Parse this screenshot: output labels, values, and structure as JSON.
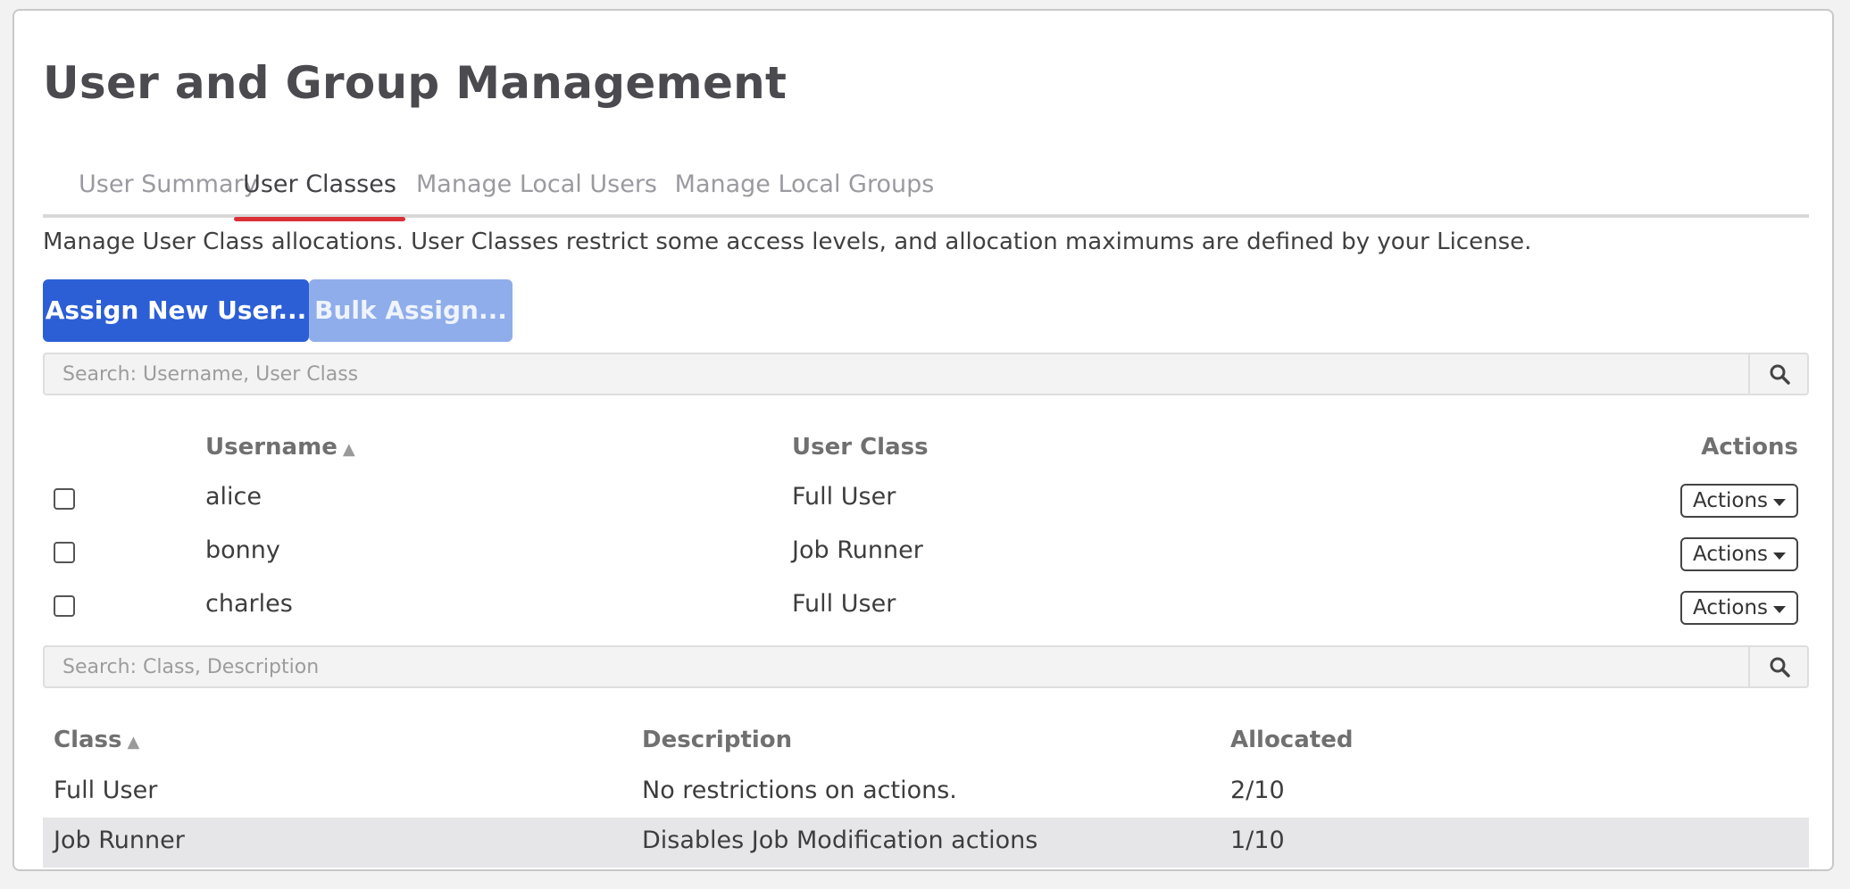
{
  "page": {
    "title": "User and Group Management"
  },
  "tabs": [
    {
      "label": "User Summary",
      "active": false
    },
    {
      "label": "User Classes",
      "active": true
    },
    {
      "label": "Manage Local Users",
      "active": false
    },
    {
      "label": "Manage Local Groups",
      "active": false
    }
  ],
  "intro_text": "Manage User Class allocations. User Classes restrict some access levels, and allocation maximums are defined by your License.",
  "toolbar": {
    "assign_label": "Assign New User...",
    "bulk_label": "Bulk Assign..."
  },
  "user_search": {
    "placeholder": "Search: Username, User Class",
    "value": ""
  },
  "users_table": {
    "headers": {
      "username": "Username",
      "user_class": "User Class",
      "actions": "Actions"
    },
    "sort_indicator": "▲",
    "rows": [
      {
        "username": "alice",
        "user_class": "Full User",
        "action_label": "Actions",
        "checked": false
      },
      {
        "username": "bonny",
        "user_class": "Job Runner",
        "action_label": "Actions",
        "checked": false
      },
      {
        "username": "charles",
        "user_class": "Full User",
        "action_label": "Actions",
        "checked": false
      }
    ]
  },
  "class_search": {
    "placeholder": "Search: Class, Description",
    "value": ""
  },
  "classes_table": {
    "headers": {
      "class": "Class",
      "description": "Description",
      "allocated": "Allocated"
    },
    "sort_indicator": "▲",
    "rows": [
      {
        "class": "Full User",
        "description": "No restrictions on actions.",
        "allocated": "2/10"
      },
      {
        "class": "Job Runner",
        "description": "Disables Job Modification actions",
        "allocated": "1/10"
      }
    ]
  },
  "colors": {
    "primary": "#2c5fd6",
    "primary_disabled": "#8fadea",
    "tab_accent": "#d93137"
  },
  "icons": {
    "search": "search-icon",
    "caret": "caret-down-icon"
  }
}
